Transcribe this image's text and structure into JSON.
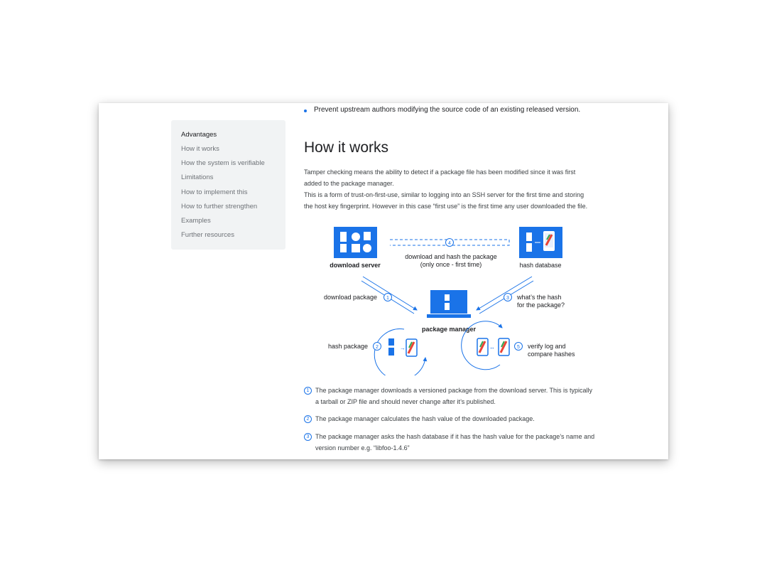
{
  "toc": {
    "items": [
      {
        "label": "Advantages",
        "active": true
      },
      {
        "label": "How it works",
        "active": false
      },
      {
        "label": "How the system is verifiable",
        "active": false
      },
      {
        "label": "Limitations",
        "active": false
      },
      {
        "label": "How to implement this",
        "active": false
      },
      {
        "label": "How to further strengthen",
        "active": false
      },
      {
        "label": "Examples",
        "active": false
      },
      {
        "label": "Further resources",
        "active": false
      }
    ]
  },
  "content": {
    "bullet": "Prevent upstream authors modifying the source code of an existing released version.",
    "heading": "How it works",
    "paragraph_lines": [
      "Tamper checking means the ability to detect if a package file has been modified since it was first",
      "added to the package manager.",
      "This is a form of trust-on-first-use, similar to logging into an SSH server for the first time and storing",
      "the host key fingerprint. However in this case “first use” is the first time any user downloaded the file."
    ]
  },
  "diagram": {
    "download_server": "download server",
    "hash_database": "hash database",
    "package_manager": "package manager",
    "step4_num": "4",
    "step4_line1": "download and hash the package",
    "step4_line2": "(only once - first time)",
    "step1_num": "1",
    "step1_label": "download package",
    "step3_num": "3",
    "step3_line1": "what’s the hash",
    "step3_line2": "for the package?",
    "step2_num": "2",
    "step2_label": "hash package",
    "step5_num": "5",
    "step5_line1": "verify log and",
    "step5_line2": "compare hashes",
    "colors": {
      "accent": "#1a73e8",
      "red": "#ea4335",
      "green": "#34a853",
      "yellow": "#fbbc04"
    }
  },
  "steps": [
    {
      "num": "1",
      "lines": [
        "The package manager downloads a versioned package from the download server. This is typically",
        "a tarball or ZIP file and should never change after it’s published."
      ]
    },
    {
      "num": "2",
      "lines": [
        "The package manager calculates the hash value of the downloaded package."
      ]
    },
    {
      "num": "3",
      "lines": [
        "The package manager asks the hash database if it has the hash value for the package’s name and",
        "version number e.g. “libfoo-1.4.6”"
      ]
    }
  ]
}
